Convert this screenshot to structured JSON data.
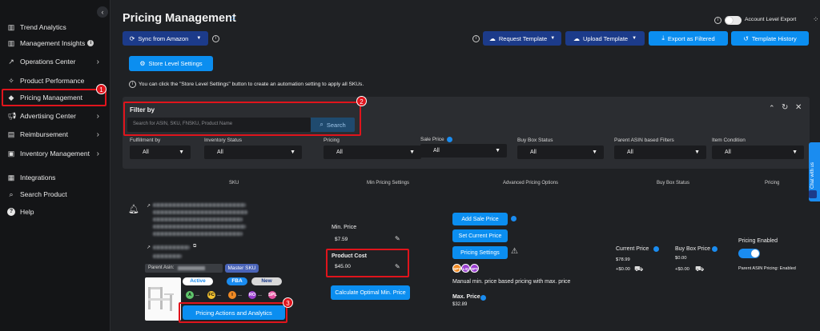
{
  "sidebar": {
    "items": [
      {
        "label": "Trend Analytics",
        "icon": "bar-chart-icon",
        "chevron": false
      },
      {
        "label": "Management Insights",
        "icon": "bar-chart-icon",
        "chevron": false,
        "info": true
      },
      {
        "label": "Operations Center",
        "icon": "trend-icon",
        "chevron": true
      },
      {
        "label": "Product Performance",
        "icon": "sparkle-icon",
        "chevron": false
      },
      {
        "label": "Pricing Management",
        "icon": "tag-icon",
        "chevron": false
      },
      {
        "label": "Advertising Center",
        "icon": "megaphone-icon",
        "chevron": true
      },
      {
        "label": "Reimbursement",
        "icon": "money-icon",
        "chevron": true
      },
      {
        "label": "Inventory Management",
        "icon": "box-icon",
        "chevron": true
      },
      {
        "label": "Integrations",
        "icon": "grid-icon",
        "chevron": false
      },
      {
        "label": "Search Product",
        "icon": "search-icon",
        "chevron": false
      },
      {
        "label": "Help",
        "icon": "help-icon",
        "chevron": false
      }
    ],
    "collapse_glyph": "‹"
  },
  "callouts": [
    "1",
    "2",
    "3"
  ],
  "header": {
    "title": "Pricing Management",
    "account_level_export": "Account Level Export"
  },
  "toolbar": {
    "sync": "Sync from Amazon",
    "request_template": "Request Template",
    "upload_template": "Upload Template",
    "export_filtered": "Export as Filtered",
    "template_history": "Template History"
  },
  "store_level": {
    "button": "Store Level Settings",
    "hint": "You can click the \"Store Level Settings\" button to create an automation setting to apply all SKUs."
  },
  "filter": {
    "title": "Filter by",
    "search_placeholder": "Search for ASIN, SKU, FNSKU, Product Name",
    "search_button": "Search",
    "fields": [
      {
        "label": "Fulfillment by",
        "value": "All"
      },
      {
        "label": "Inventory Status",
        "value": "All"
      },
      {
        "label": "Pricing",
        "value": "All"
      },
      {
        "label": "Sale Price",
        "value": "All"
      },
      {
        "label": "Buy Box Status",
        "value": "All"
      },
      {
        "label": "Parent ASIN based Filters",
        "value": "All"
      },
      {
        "label": "Item Condition",
        "value": "All"
      }
    ]
  },
  "table": {
    "headers": [
      "SKU",
      "Min Pricing Settings",
      "Advanced Pricing Options",
      "Buy Box Status",
      "Pricing"
    ]
  },
  "row": {
    "parent_asin_label": "Parent Asin:",
    "master_sku": "Master SKU",
    "statuses": [
      "Active",
      "FBA",
      "New"
    ],
    "tags": [
      {
        "code": "A",
        "color": "#5fc46b"
      },
      {
        "code": "FC",
        "color": "#f2c230"
      },
      {
        "code": "I",
        "color": "#f08a24"
      },
      {
        "code": "RO",
        "color": "#9b3fd0"
      },
      {
        "code": "SPL",
        "color": "#e64fa0"
      }
    ],
    "pricing_actions": "Pricing Actions and Analytics",
    "min_price_label": "Min. Price",
    "min_price": "$7.59",
    "product_cost_label": "Product Cost",
    "product_cost": "$45.00",
    "calc_button": "Calculate Optimal Min. Price",
    "add_sale_price": "Add Sale Price",
    "set_current_price": "Set Current Price",
    "pricing_settings": "Pricing Settings",
    "strategy_badges": [
      {
        "code": "SPT",
        "color": "#f08a24"
      },
      {
        "code": "LIQ",
        "color": "#9b3fd0"
      },
      {
        "code": "SPT",
        "color": "#9b3fd0"
      }
    ],
    "strategy_text": "Manual min. price based pricing with max. price",
    "max_price_label": "Max. Price",
    "max_price": "$32.89",
    "current_price_label": "Current Price",
    "current_price": "$78.99",
    "current_shipping": "+$0.00",
    "buy_box_label": "Buy Box Price",
    "buy_box_price": "$0.00",
    "buy_box_shipping": "+$0.00",
    "pricing_enabled_label": "Pricing Enabled",
    "parent_asin_pricing": "Parent ASIN Pricing: Enabled"
  },
  "chat": {
    "label": "Chat with us"
  },
  "colors": {
    "accent": "#0b8ef0",
    "dark_button": "#1c3b8a",
    "highlight": "#e0141c"
  }
}
